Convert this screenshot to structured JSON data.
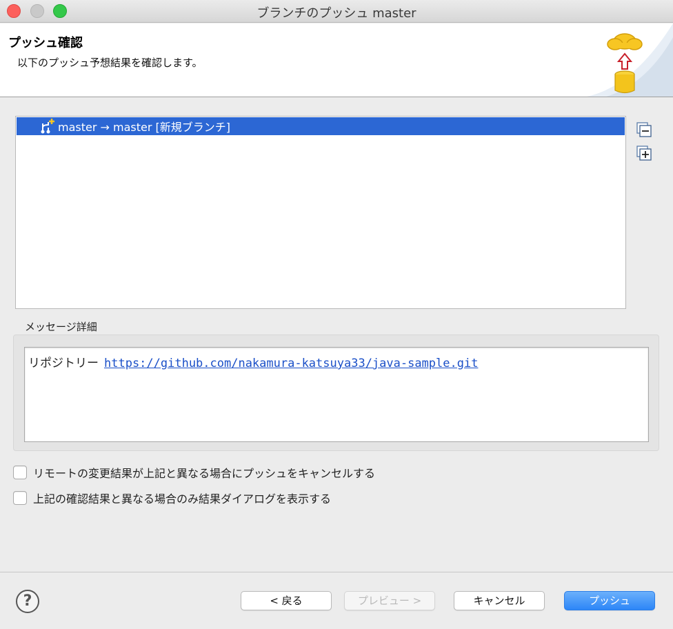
{
  "window": {
    "title": "ブランチのプッシュ master"
  },
  "banner": {
    "title": "プッシュ確認",
    "description": "以下のプッシュ予想結果を確認します。"
  },
  "refs": [
    {
      "label": "master → master [新規ブランチ]",
      "selected": true
    }
  ],
  "message": {
    "section_label": "メッセージ詳細",
    "repo_prefix": "リポジトリー",
    "repo_url": "https://github.com/nakamura-katsuya33/java-sample.git"
  },
  "options": {
    "cancel_if_changed": {
      "label": "リモートの変更結果が上記と異なる場合にプッシュをキャンセルする",
      "checked": false
    },
    "show_dialog_if_different": {
      "label": "上記の確認結果と異なる場合のみ結果ダイアログを表示する",
      "checked": false
    }
  },
  "buttons": {
    "back": "< 戻る",
    "preview": "プレビュー >",
    "cancel": "キャンセル",
    "push": "プッシュ"
  },
  "colors": {
    "selection": "#2c67d4",
    "primary_button": "#2d86f7",
    "link": "#1a4fc8"
  }
}
